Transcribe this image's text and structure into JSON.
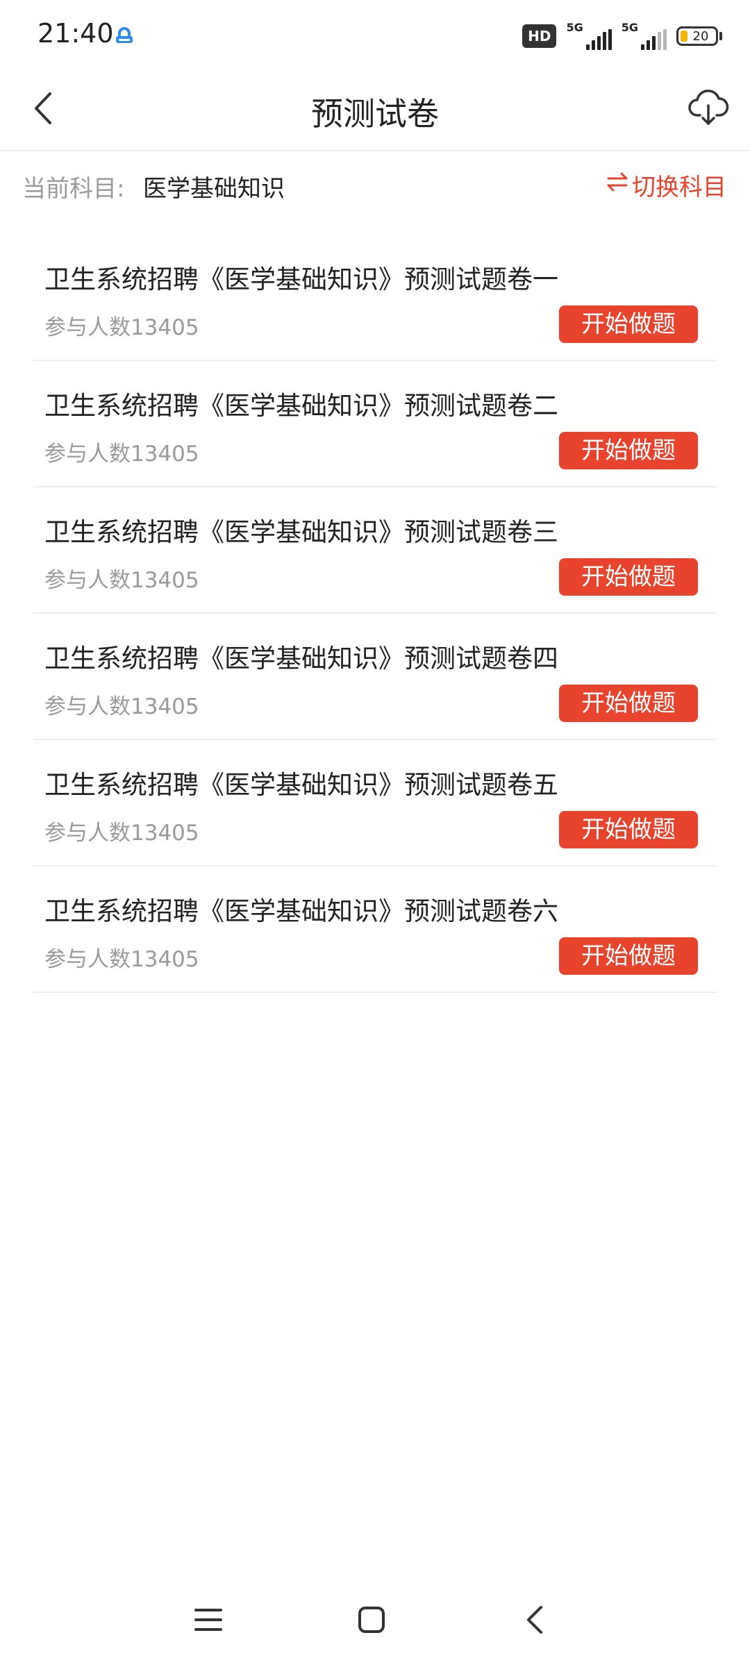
{
  "status_bar": {
    "time": "21:40",
    "hd_label": "HD",
    "network_1": "5G",
    "network_2": "5G",
    "battery_level": "20",
    "battery_color": "#f2b705"
  },
  "header": {
    "title": "预测试卷",
    "back_icon": "chevron-left-icon",
    "download_icon": "cloud-download-icon"
  },
  "subject": {
    "label": "当前科目:",
    "value": "医学基础知识",
    "switch_label": "切换科目",
    "switch_icon": "swap-arrows-icon"
  },
  "papers": [
    {
      "title": "卫生系统招聘《医学基础知识》预测试题卷一",
      "count": "参与人数13405",
      "button": "开始做题"
    },
    {
      "title": "卫生系统招聘《医学基础知识》预测试题卷二",
      "count": "参与人数13405",
      "button": "开始做题"
    },
    {
      "title": "卫生系统招聘《医学基础知识》预测试题卷三",
      "count": "参与人数13405",
      "button": "开始做题"
    },
    {
      "title": "卫生系统招聘《医学基础知识》预测试题卷四",
      "count": "参与人数13405",
      "button": "开始做题"
    },
    {
      "title": "卫生系统招聘《医学基础知识》预测试题卷五",
      "count": "参与人数13405",
      "button": "开始做题"
    },
    {
      "title": "卫生系统招聘《医学基础知识》预测试题卷六",
      "count": "参与人数13405",
      "button": "开始做题"
    }
  ],
  "nav_bar": {
    "menu_icon": "menu-icon",
    "home_icon": "home-square-icon",
    "back_icon": "back-triangle-icon"
  },
  "colors": {
    "accent": "#e8432c",
    "secondary_text": "#9a9a9a",
    "primary_text": "#222222"
  }
}
